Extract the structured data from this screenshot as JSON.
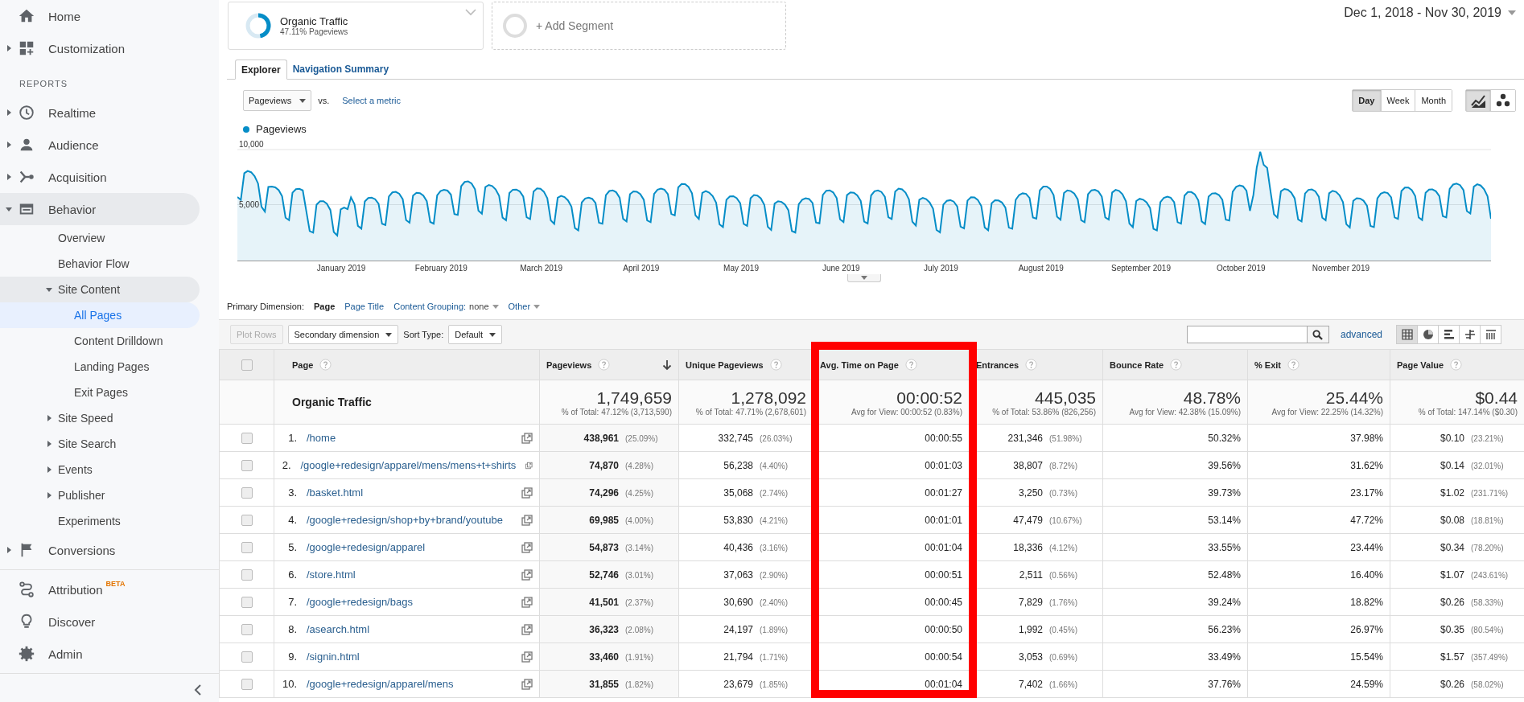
{
  "sidebar": {
    "top": [
      {
        "label": "Home",
        "selected": false
      },
      {
        "label": "Customization",
        "selected": false,
        "expanded": false
      }
    ],
    "section_label": "REPORTS",
    "reports": [
      {
        "label": "Realtime",
        "selected": false,
        "expanded": false
      },
      {
        "label": "Audience",
        "selected": false,
        "expanded": false
      },
      {
        "label": "Acquisition",
        "selected": false,
        "expanded": false
      },
      {
        "label": "Behavior",
        "selected": false,
        "expanded": true,
        "children": [
          {
            "label": "Overview",
            "selected": false
          },
          {
            "label": "Behavior Flow",
            "selected": false
          },
          {
            "label": "Site Content",
            "selected": false,
            "expanded": true,
            "children": [
              {
                "label": "All Pages",
                "selected": true
              },
              {
                "label": "Content Drilldown",
                "selected": false
              },
              {
                "label": "Landing Pages",
                "selected": false
              },
              {
                "label": "Exit Pages",
                "selected": false
              }
            ]
          },
          {
            "label": "Site Speed",
            "selected": false,
            "expanded": false
          },
          {
            "label": "Site Search",
            "selected": false,
            "expanded": false
          },
          {
            "label": "Events",
            "selected": false,
            "expanded": false
          },
          {
            "label": "Publisher",
            "selected": false,
            "expanded": false
          },
          {
            "label": "Experiments",
            "selected": false
          }
        ]
      },
      {
        "label": "Conversions",
        "selected": false,
        "expanded": false
      }
    ],
    "bottom": [
      {
        "label": "Attribution",
        "badge": "BETA",
        "selected": false
      },
      {
        "label": "Discover",
        "selected": false
      },
      {
        "label": "Admin",
        "selected": false
      }
    ]
  },
  "segments": [
    {
      "name": "Organic Traffic",
      "detail": "47.11% Pageviews",
      "level": 0.4711
    }
  ],
  "add_segment": "+ Add Segment",
  "date_range": "Dec 1, 2018 - Nov 30, 2019",
  "tabs": [
    {
      "label": "Explorer",
      "selected": true
    },
    {
      "label": "Navigation Summary",
      "selected": false
    }
  ],
  "metric": {
    "value": "Pageviews",
    "vs": "vs.",
    "compare": "Select a metric"
  },
  "periods": [
    {
      "label": "Day",
      "selected": true
    },
    {
      "label": "Week",
      "selected": false
    },
    {
      "label": "Month",
      "selected": false
    }
  ],
  "chart_views": [
    {
      "selected": true
    },
    {
      "selected": false
    }
  ],
  "chart": {
    "legend": {
      "label": "Pageviews",
      "color": "#058dc7"
    },
    "y_labels": [
      "10,000",
      "5,000"
    ],
    "x_labels": [
      "January 2019",
      "February 2019",
      "March 2019",
      "April 2019",
      "May 2019",
      "June 2019",
      "July 2019",
      "August 2019",
      "September 2019",
      "October 2019",
      "November 2019"
    ]
  },
  "dimensions": {
    "label": "Primary Dimension:",
    "options": [
      {
        "kind": "link",
        "label": "Page",
        "selected": true
      },
      {
        "kind": "link",
        "label": "Page Title",
        "selected": false
      },
      {
        "kind": "dropdown",
        "label": "Content Grouping:",
        "value": "none",
        "selected": false
      },
      {
        "kind": "dropdown",
        "label": "Other",
        "selected": false
      }
    ]
  },
  "toolbar": {
    "plot_rows": {
      "label": "Plot Rows",
      "disabled": true
    },
    "secondary": "Secondary dimension",
    "sort_label": "Sort Type:",
    "sort_value": "Default",
    "advanced": "advanced",
    "views": [
      {
        "selected": true
      },
      {
        "selected": false
      },
      {
        "selected": false
      },
      {
        "selected": false
      },
      {
        "selected": false
      }
    ]
  },
  "table": {
    "select_all": {
      "checked": false
    },
    "columns": [
      {
        "label": "Page",
        "sorted": false,
        "highlighted": false
      },
      {
        "label": "Pageviews",
        "sorted": true,
        "highlighted": false
      },
      {
        "label": "Unique Pageviews",
        "sorted": false,
        "highlighted": false
      },
      {
        "label": "Avg. Time on Page",
        "sorted": false,
        "highlighted": true
      },
      {
        "label": "Entrances",
        "sorted": false,
        "highlighted": false
      },
      {
        "label": "Bounce Rate",
        "sorted": false,
        "highlighted": false
      },
      {
        "label": "% Exit",
        "sorted": false,
        "highlighted": false
      },
      {
        "label": "Page Value",
        "sorted": false,
        "highlighted": false
      }
    ],
    "summary": {
      "label": "Organic Traffic",
      "totals": [
        {
          "value": "1,749,659",
          "detail": "% of Total: 47.12% (3,713,590)"
        },
        {
          "value": "1,278,092",
          "detail": "% of Total: 47.71% (2,678,601)"
        },
        {
          "value": "00:00:52",
          "detail": "Avg for View: 00:00:52 (0.83%)"
        },
        {
          "value": "445,035",
          "detail": "% of Total: 53.86% (826,256)"
        },
        {
          "value": "48.78%",
          "detail": "Avg for View: 42.38% (15.09%)"
        },
        {
          "value": "25.44%",
          "detail": "Avg for View: 22.25% (14.32%)"
        },
        {
          "value": "$0.44",
          "detail": "% of Total: 147.14% ($0.30)"
        }
      ]
    },
    "rows": [
      {
        "checked": false,
        "cells": [
          {
            "number": "1.",
            "value": "/home"
          },
          {
            "value": "438,961",
            "share": "(25.09%)"
          },
          {
            "value": "332,745",
            "share": "(26.03%)"
          },
          {
            "value": "00:00:55"
          },
          {
            "value": "231,346",
            "share": "(51.98%)"
          },
          {
            "value": "50.32%"
          },
          {
            "value": "37.98%"
          },
          {
            "value": "$0.10",
            "share": "(23.21%)"
          }
        ]
      },
      {
        "checked": false,
        "cells": [
          {
            "number": "2.",
            "value": "/google+redesign/apparel/mens/mens+t+shirts"
          },
          {
            "value": "74,870",
            "share": "(4.28%)"
          },
          {
            "value": "56,238",
            "share": "(4.40%)"
          },
          {
            "value": "00:01:03"
          },
          {
            "value": "38,807",
            "share": "(8.72%)"
          },
          {
            "value": "39.56%"
          },
          {
            "value": "31.62%"
          },
          {
            "value": "$0.14",
            "share": "(32.01%)"
          }
        ]
      },
      {
        "checked": false,
        "cells": [
          {
            "number": "3.",
            "value": "/basket.html"
          },
          {
            "value": "74,296",
            "share": "(4.25%)"
          },
          {
            "value": "35,068",
            "share": "(2.74%)"
          },
          {
            "value": "00:01:27"
          },
          {
            "value": "3,250",
            "share": "(0.73%)"
          },
          {
            "value": "39.73%"
          },
          {
            "value": "23.17%"
          },
          {
            "value": "$1.02",
            "share": "(231.71%)"
          }
        ]
      },
      {
        "checked": false,
        "cells": [
          {
            "number": "4.",
            "value": "/google+redesign/shop+by+brand/youtube"
          },
          {
            "value": "69,985",
            "share": "(4.00%)"
          },
          {
            "value": "53,830",
            "share": "(4.21%)"
          },
          {
            "value": "00:01:01"
          },
          {
            "value": "47,479",
            "share": "(10.67%)"
          },
          {
            "value": "53.14%"
          },
          {
            "value": "47.72%"
          },
          {
            "value": "$0.08",
            "share": "(18.81%)"
          }
        ]
      },
      {
        "checked": false,
        "cells": [
          {
            "number": "5.",
            "value": "/google+redesign/apparel"
          },
          {
            "value": "54,873",
            "share": "(3.14%)"
          },
          {
            "value": "40,436",
            "share": "(3.16%)"
          },
          {
            "value": "00:01:04"
          },
          {
            "value": "18,336",
            "share": "(4.12%)"
          },
          {
            "value": "33.55%"
          },
          {
            "value": "23.44%"
          },
          {
            "value": "$0.34",
            "share": "(78.20%)"
          }
        ]
      },
      {
        "checked": false,
        "cells": [
          {
            "number": "6.",
            "value": "/store.html"
          },
          {
            "value": "52,746",
            "share": "(3.01%)"
          },
          {
            "value": "37,063",
            "share": "(2.90%)"
          },
          {
            "value": "00:00:51"
          },
          {
            "value": "2,511",
            "share": "(0.56%)"
          },
          {
            "value": "52.48%"
          },
          {
            "value": "16.40%"
          },
          {
            "value": "$1.07",
            "share": "(243.61%)"
          }
        ]
      },
      {
        "checked": false,
        "cells": [
          {
            "number": "7.",
            "value": "/google+redesign/bags"
          },
          {
            "value": "41,501",
            "share": "(2.37%)"
          },
          {
            "value": "30,690",
            "share": "(2.40%)"
          },
          {
            "value": "00:00:45"
          },
          {
            "value": "7,829",
            "share": "(1.76%)"
          },
          {
            "value": "39.24%"
          },
          {
            "value": "18.82%"
          },
          {
            "value": "$0.26",
            "share": "(58.33%)"
          }
        ]
      },
      {
        "checked": false,
        "cells": [
          {
            "number": "8.",
            "value": "/asearch.html"
          },
          {
            "value": "36,323",
            "share": "(2.08%)"
          },
          {
            "value": "24,197",
            "share": "(1.89%)"
          },
          {
            "value": "00:00:50"
          },
          {
            "value": "1,992",
            "share": "(0.45%)"
          },
          {
            "value": "56.23%"
          },
          {
            "value": "26.97%"
          },
          {
            "value": "$0.35",
            "share": "(80.54%)"
          }
        ]
      },
      {
        "checked": false,
        "cells": [
          {
            "number": "9.",
            "value": "/signin.html"
          },
          {
            "value": "33,460",
            "share": "(1.91%)"
          },
          {
            "value": "21,794",
            "share": "(1.71%)"
          },
          {
            "value": "00:00:54"
          },
          {
            "value": "3,053",
            "share": "(0.69%)"
          },
          {
            "value": "33.49%"
          },
          {
            "value": "15.54%"
          },
          {
            "value": "$1.57",
            "share": "(357.49%)"
          }
        ]
      },
      {
        "checked": false,
        "cells": [
          {
            "number": "10.",
            "value": "/google+redesign/apparel/mens"
          },
          {
            "value": "31,855",
            "share": "(1.82%)"
          },
          {
            "value": "23,679",
            "share": "(1.85%)"
          },
          {
            "value": "00:01:04"
          },
          {
            "value": "7,402",
            "share": "(1.66%)"
          },
          {
            "value": "37.76%"
          },
          {
            "value": "24.59%"
          },
          {
            "value": "$0.26",
            "share": "(58.02%)"
          }
        ]
      }
    ]
  }
}
